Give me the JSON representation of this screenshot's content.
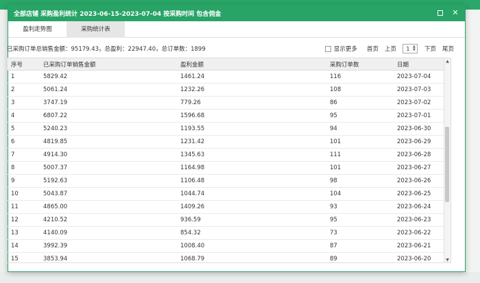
{
  "modal": {
    "title": "全部店铺 采购盈利统计 2023-06-15-2023-07-04 按采购时间 包含佣金",
    "tabs": [
      {
        "label": "盈利走势图",
        "active": false
      },
      {
        "label": "采购统计表",
        "active": true
      }
    ]
  },
  "summary": {
    "text": "已采购订单总销售金额：95179.43，总盈利：22947.40，总订单数：1899"
  },
  "pager": {
    "show_more_label": "显示更多",
    "first_label": "首页",
    "prev_label": "上页",
    "page_value": "1",
    "next_label": "下页",
    "last_label": "尾页"
  },
  "table": {
    "headers": {
      "idx": "序号",
      "sales": "已采购订单销售金额",
      "profit": "盈利金额",
      "orders": "采购订单数",
      "date": "日期"
    },
    "rows": [
      {
        "idx": "1",
        "sales": "5829.42",
        "profit": "1461.24",
        "orders": "116",
        "date": "2023-07-04"
      },
      {
        "idx": "2",
        "sales": "5061.24",
        "profit": "1232.26",
        "orders": "108",
        "date": "2023-07-03"
      },
      {
        "idx": "3",
        "sales": "3747.19",
        "profit": "779.26",
        "orders": "86",
        "date": "2023-07-02"
      },
      {
        "idx": "4",
        "sales": "6807.22",
        "profit": "1596.68",
        "orders": "95",
        "date": "2023-07-01"
      },
      {
        "idx": "5",
        "sales": "5240.23",
        "profit": "1193.55",
        "orders": "94",
        "date": "2023-06-30"
      },
      {
        "idx": "6",
        "sales": "4819.85",
        "profit": "1231.42",
        "orders": "101",
        "date": "2023-06-29"
      },
      {
        "idx": "7",
        "sales": "4914.30",
        "profit": "1345.63",
        "orders": "111",
        "date": "2023-06-28"
      },
      {
        "idx": "8",
        "sales": "5007.37",
        "profit": "1164.98",
        "orders": "101",
        "date": "2023-06-27"
      },
      {
        "idx": "9",
        "sales": "5192.63",
        "profit": "1106.48",
        "orders": "98",
        "date": "2023-06-26"
      },
      {
        "idx": "10",
        "sales": "5043.87",
        "profit": "1044.74",
        "orders": "104",
        "date": "2023-06-25"
      },
      {
        "idx": "11",
        "sales": "4865.00",
        "profit": "1409.26",
        "orders": "93",
        "date": "2023-06-24"
      },
      {
        "idx": "12",
        "sales": "4210.52",
        "profit": "936.59",
        "orders": "95",
        "date": "2023-06-23"
      },
      {
        "idx": "13",
        "sales": "4140.09",
        "profit": "854.32",
        "orders": "73",
        "date": "2023-06-22"
      },
      {
        "idx": "14",
        "sales": "3992.39",
        "profit": "1008.40",
        "orders": "87",
        "date": "2023-06-21"
      },
      {
        "idx": "15",
        "sales": "3853.94",
        "profit": "1068.79",
        "orders": "89",
        "date": "2023-06-20"
      }
    ]
  },
  "icons": {
    "maximize": "maximize-icon",
    "close": "close-icon"
  },
  "colors": {
    "accent": "#27a466"
  }
}
